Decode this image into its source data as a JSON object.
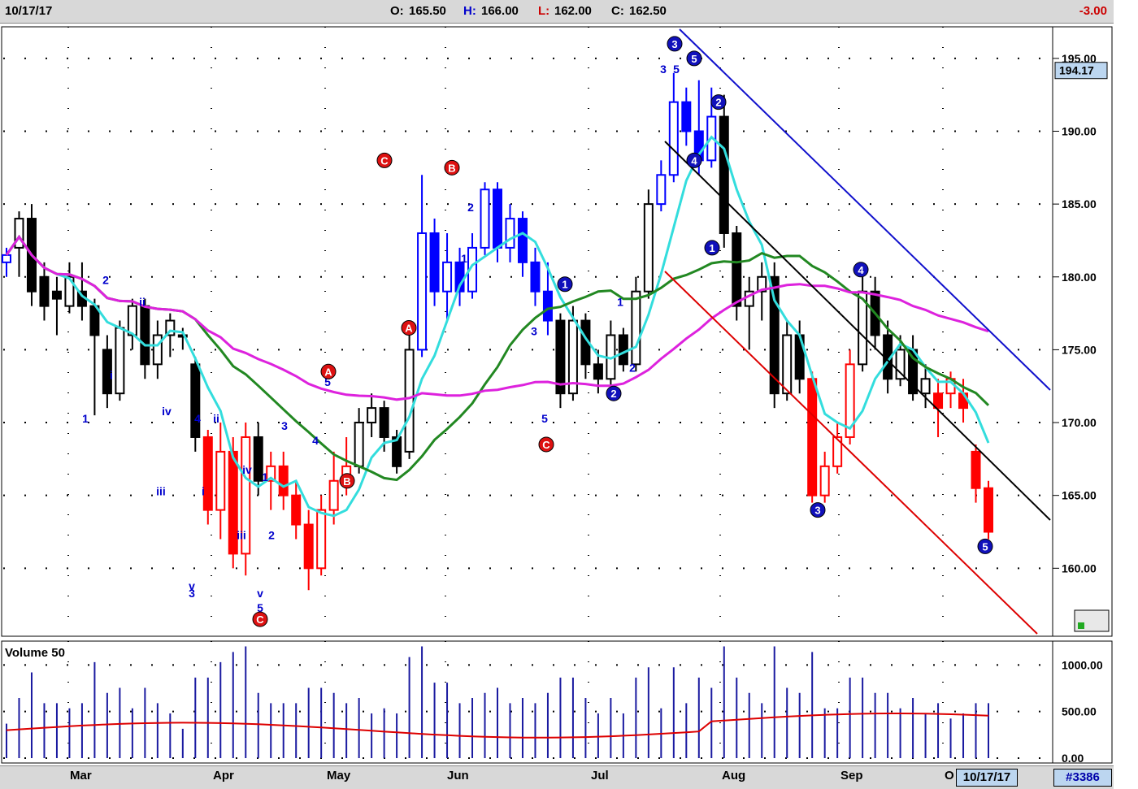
{
  "header": {
    "date": "10/17/17",
    "open_label": "O:",
    "open": "165.50",
    "high_label": "H:",
    "high": "166.00",
    "low_label": "L:",
    "low": "162.00",
    "close_label": "C:",
    "close": "162.50",
    "change": "-3.00"
  },
  "footer": {
    "months": [
      "Mar",
      "Apr",
      "May",
      "Jun",
      "Jul",
      "Aug",
      "Sep",
      "O"
    ],
    "current_date": "10/17/17",
    "chart_id": "#3386"
  },
  "volume_title": "Volume 50",
  "last_price_label": "194.17",
  "colors": {
    "up": "#0000ff",
    "down": "#ff0000",
    "neutral": "#000000",
    "ma_cyan": "#33dddd",
    "ma_green": "#228822",
    "ma_magenta": "#dd22dd"
  },
  "chart_data": {
    "type": "candlestick",
    "price_axis": {
      "ticks": [
        160.0,
        165.0,
        170.0,
        175.0,
        180.0,
        185.0,
        190.0,
        195.0
      ],
      "range": [
        155.5,
        197
      ]
    },
    "volume_axis": {
      "ticks": [
        0.0,
        500.0,
        1000.0
      ],
      "range": [
        0,
        1230
      ]
    },
    "candles": [
      {
        "o": 181,
        "h": 182,
        "l": 180,
        "c": 181.5,
        "k": "u"
      },
      {
        "o": 182,
        "h": 184.5,
        "l": 180,
        "c": 184,
        "k": "n"
      },
      {
        "o": 184,
        "h": 185,
        "l": 178,
        "c": 179,
        "k": "n"
      },
      {
        "o": 180,
        "h": 181,
        "l": 177,
        "c": 178,
        "k": "n"
      },
      {
        "o": 179,
        "h": 180,
        "l": 176,
        "c": 178.5,
        "k": "n"
      },
      {
        "o": 178,
        "h": 181,
        "l": 177.5,
        "c": 180,
        "k": "n"
      },
      {
        "o": 179,
        "h": 181,
        "l": 177,
        "c": 178,
        "k": "n"
      },
      {
        "o": 178,
        "h": 178.5,
        "l": 170.5,
        "c": 176,
        "k": "n"
      },
      {
        "o": 175,
        "h": 176,
        "l": 171,
        "c": 172,
        "k": "n"
      },
      {
        "o": 172,
        "h": 177,
        "l": 171.5,
        "c": 176.5,
        "k": "n"
      },
      {
        "o": 176,
        "h": 178.5,
        "l": 175,
        "c": 178,
        "k": "n"
      },
      {
        "o": 178,
        "h": 178.5,
        "l": 173,
        "c": 174,
        "k": "n"
      },
      {
        "o": 174,
        "h": 177,
        "l": 173,
        "c": 176,
        "k": "n"
      },
      {
        "o": 176,
        "h": 177.5,
        "l": 174.5,
        "c": 177,
        "k": "n"
      },
      {
        "o": 176,
        "h": 176.5,
        "l": 175,
        "c": 176,
        "k": "n"
      },
      {
        "o": 174,
        "h": 174.5,
        "l": 168,
        "c": 169,
        "k": "n"
      },
      {
        "o": 169,
        "h": 169.5,
        "l": 163,
        "c": 164,
        "k": "d"
      },
      {
        "o": 164,
        "h": 170,
        "l": 162,
        "c": 168,
        "k": "d"
      },
      {
        "o": 168,
        "h": 169,
        "l": 160,
        "c": 161,
        "k": "d"
      },
      {
        "o": 161,
        "h": 170,
        "l": 159.5,
        "c": 169,
        "k": "d"
      },
      {
        "o": 169,
        "h": 170,
        "l": 165,
        "c": 166,
        "k": "n"
      },
      {
        "o": 166,
        "h": 168,
        "l": 164,
        "c": 167,
        "k": "d"
      },
      {
        "o": 167,
        "h": 168,
        "l": 164,
        "c": 165,
        "k": "d"
      },
      {
        "o": 165,
        "h": 166,
        "l": 162,
        "c": 163,
        "k": "d"
      },
      {
        "o": 163,
        "h": 164,
        "l": 158.5,
        "c": 160,
        "k": "d"
      },
      {
        "o": 160,
        "h": 165,
        "l": 159.5,
        "c": 164,
        "k": "d"
      },
      {
        "o": 164,
        "h": 168,
        "l": 163,
        "c": 166,
        "k": "d"
      },
      {
        "o": 166,
        "h": 169,
        "l": 165,
        "c": 167,
        "k": "d"
      },
      {
        "o": 167,
        "h": 171,
        "l": 166.5,
        "c": 170,
        "k": "n"
      },
      {
        "o": 170,
        "h": 172,
        "l": 169,
        "c": 171,
        "k": "n"
      },
      {
        "o": 171,
        "h": 171.5,
        "l": 168,
        "c": 169,
        "k": "n"
      },
      {
        "o": 169,
        "h": 169.5,
        "l": 166.5,
        "c": 167,
        "k": "n"
      },
      {
        "o": 168,
        "h": 176,
        "l": 167.5,
        "c": 175,
        "k": "n"
      },
      {
        "o": 175,
        "h": 187,
        "l": 174.5,
        "c": 183,
        "k": "u"
      },
      {
        "o": 183,
        "h": 184,
        "l": 178,
        "c": 179,
        "k": "u"
      },
      {
        "o": 179,
        "h": 183,
        "l": 177,
        "c": 181,
        "k": "u"
      },
      {
        "o": 181,
        "h": 182,
        "l": 178,
        "c": 179,
        "k": "u"
      },
      {
        "o": 179,
        "h": 183,
        "l": 178.5,
        "c": 182,
        "k": "u"
      },
      {
        "o": 182,
        "h": 186.5,
        "l": 181.5,
        "c": 186,
        "k": "u"
      },
      {
        "o": 186,
        "h": 186.5,
        "l": 181,
        "c": 182,
        "k": "u"
      },
      {
        "o": 182,
        "h": 185,
        "l": 181,
        "c": 184,
        "k": "u"
      },
      {
        "o": 184,
        "h": 184.5,
        "l": 180,
        "c": 181,
        "k": "u"
      },
      {
        "o": 181,
        "h": 182,
        "l": 178,
        "c": 179,
        "k": "u"
      },
      {
        "o": 179,
        "h": 181,
        "l": 176,
        "c": 177,
        "k": "u"
      },
      {
        "o": 177,
        "h": 177.5,
        "l": 171,
        "c": 172,
        "k": "n"
      },
      {
        "o": 172,
        "h": 178,
        "l": 171.5,
        "c": 177,
        "k": "n"
      },
      {
        "o": 177,
        "h": 177.5,
        "l": 173,
        "c": 174,
        "k": "n"
      },
      {
        "o": 174,
        "h": 175,
        "l": 172,
        "c": 173,
        "k": "n"
      },
      {
        "o": 173,
        "h": 177,
        "l": 172.5,
        "c": 176,
        "k": "n"
      },
      {
        "o": 176,
        "h": 176.5,
        "l": 173.5,
        "c": 174,
        "k": "n"
      },
      {
        "o": 174,
        "h": 180,
        "l": 173.5,
        "c": 179,
        "k": "n"
      },
      {
        "o": 179,
        "h": 186,
        "l": 178.5,
        "c": 185,
        "k": "n"
      },
      {
        "o": 185,
        "h": 188,
        "l": 184.5,
        "c": 187,
        "k": "u"
      },
      {
        "o": 187,
        "h": 194,
        "l": 186.5,
        "c": 192,
        "k": "u"
      },
      {
        "o": 192,
        "h": 193,
        "l": 189,
        "c": 190,
        "k": "u"
      },
      {
        "o": 190,
        "h": 193.5,
        "l": 187,
        "c": 188,
        "k": "u"
      },
      {
        "o": 188,
        "h": 193,
        "l": 187.5,
        "c": 191,
        "k": "u"
      },
      {
        "o": 191,
        "h": 192.5,
        "l": 182,
        "c": 183,
        "k": "n"
      },
      {
        "o": 183,
        "h": 183.5,
        "l": 177,
        "c": 178,
        "k": "n"
      },
      {
        "o": 178,
        "h": 180,
        "l": 175,
        "c": 179,
        "k": "n"
      },
      {
        "o": 179,
        "h": 181,
        "l": 177,
        "c": 180,
        "k": "n"
      },
      {
        "o": 180,
        "h": 181,
        "l": 171,
        "c": 172,
        "k": "n"
      },
      {
        "o": 172,
        "h": 177,
        "l": 171.5,
        "c": 176,
        "k": "n"
      },
      {
        "o": 176,
        "h": 177,
        "l": 172,
        "c": 173,
        "k": "n"
      },
      {
        "o": 173,
        "h": 173.5,
        "l": 164.5,
        "c": 165,
        "k": "d"
      },
      {
        "o": 165,
        "h": 168,
        "l": 164.5,
        "c": 167,
        "k": "d"
      },
      {
        "o": 167,
        "h": 170,
        "l": 166.5,
        "c": 169,
        "k": "d"
      },
      {
        "o": 169,
        "h": 175,
        "l": 168.5,
        "c": 174,
        "k": "d"
      },
      {
        "o": 174,
        "h": 180,
        "l": 173.5,
        "c": 179,
        "k": "n"
      },
      {
        "o": 179,
        "h": 180,
        "l": 175,
        "c": 176,
        "k": "n"
      },
      {
        "o": 176,
        "h": 177,
        "l": 172,
        "c": 173,
        "k": "n"
      },
      {
        "o": 173,
        "h": 176,
        "l": 172.5,
        "c": 175,
        "k": "n"
      },
      {
        "o": 175,
        "h": 176,
        "l": 171.5,
        "c": 172,
        "k": "n"
      },
      {
        "o": 172,
        "h": 174,
        "l": 171,
        "c": 173,
        "k": "n"
      },
      {
        "o": 172,
        "h": 173,
        "l": 169,
        "c": 171,
        "k": "d"
      },
      {
        "o": 172,
        "h": 173.5,
        "l": 171,
        "c": 173,
        "k": "d"
      },
      {
        "o": 172,
        "h": 173,
        "l": 170,
        "c": 171,
        "k": "d"
      },
      {
        "o": 168,
        "h": 168.5,
        "l": 164.5,
        "c": 165.5,
        "k": "d"
      },
      {
        "o": 165.5,
        "h": 166,
        "l": 162,
        "c": 162.5,
        "k": "d"
      }
    ],
    "wave_labels": [
      {
        "t": "1",
        "p": 170
      },
      {
        "t": "2",
        "p": 179.5
      },
      {
        "t": "i",
        "p": 173
      },
      {
        "t": "ii",
        "p": 178
      },
      {
        "t": "iv",
        "p": 170.5
      },
      {
        "t": "iii",
        "p": 165
      },
      {
        "t": "4",
        "p": 170
      },
      {
        "t": "i",
        "p": 165
      },
      {
        "t": "ii",
        "p": 170
      },
      {
        "t": "v",
        "p": 158.5
      },
      {
        "t": "3",
        "p": 158
      },
      {
        "t": "iv",
        "p": 166.5
      },
      {
        "t": "iii",
        "p": 162
      },
      {
        "t": "1",
        "p": 166
      },
      {
        "t": "2",
        "p": 162
      },
      {
        "t": "v",
        "p": 158
      },
      {
        "t": "5",
        "p": 157
      },
      {
        "t": "3",
        "p": 169.5
      },
      {
        "t": "4",
        "p": 168.5
      },
      {
        "t": "5",
        "p": 172.5
      },
      {
        "t": "2",
        "p": 184.5
      },
      {
        "t": "1",
        "p": 181
      },
      {
        "t": "3",
        "p": 176
      },
      {
        "t": "5",
        "p": 170
      },
      {
        "t": "1",
        "p": 178
      },
      {
        "t": "2",
        "p": 173.5
      },
      {
        "t": "3",
        "p": 194
      },
      {
        "t": "5",
        "p": 194
      }
    ],
    "circle_labels": [
      {
        "t": "C",
        "c": "red",
        "p": 156.5
      },
      {
        "t": "A",
        "c": "red",
        "p": 173.5
      },
      {
        "t": "B",
        "c": "red",
        "p": 166
      },
      {
        "t": "C",
        "c": "red",
        "p": 188
      },
      {
        "t": "A",
        "c": "red",
        "p": 176.5
      },
      {
        "t": "B",
        "c": "red",
        "p": 187.5
      },
      {
        "t": "C",
        "c": "red",
        "p": 168.5
      },
      {
        "t": "1",
        "c": "blue",
        "p": 179.5
      },
      {
        "t": "2",
        "c": "blue",
        "p": 172
      },
      {
        "t": "3",
        "c": "blue",
        "p": 196
      },
      {
        "t": "5",
        "c": "blue",
        "p": 195
      },
      {
        "t": "2",
        "c": "blue",
        "p": 192
      },
      {
        "t": "4",
        "c": "blue",
        "p": 188
      },
      {
        "t": "1",
        "c": "blue",
        "p": 182
      },
      {
        "t": "3",
        "c": "blue",
        "p": 164
      },
      {
        "t": "4",
        "c": "blue",
        "p": 180.5
      },
      {
        "t": "5",
        "c": "blue",
        "p": 161.5
      }
    ]
  }
}
